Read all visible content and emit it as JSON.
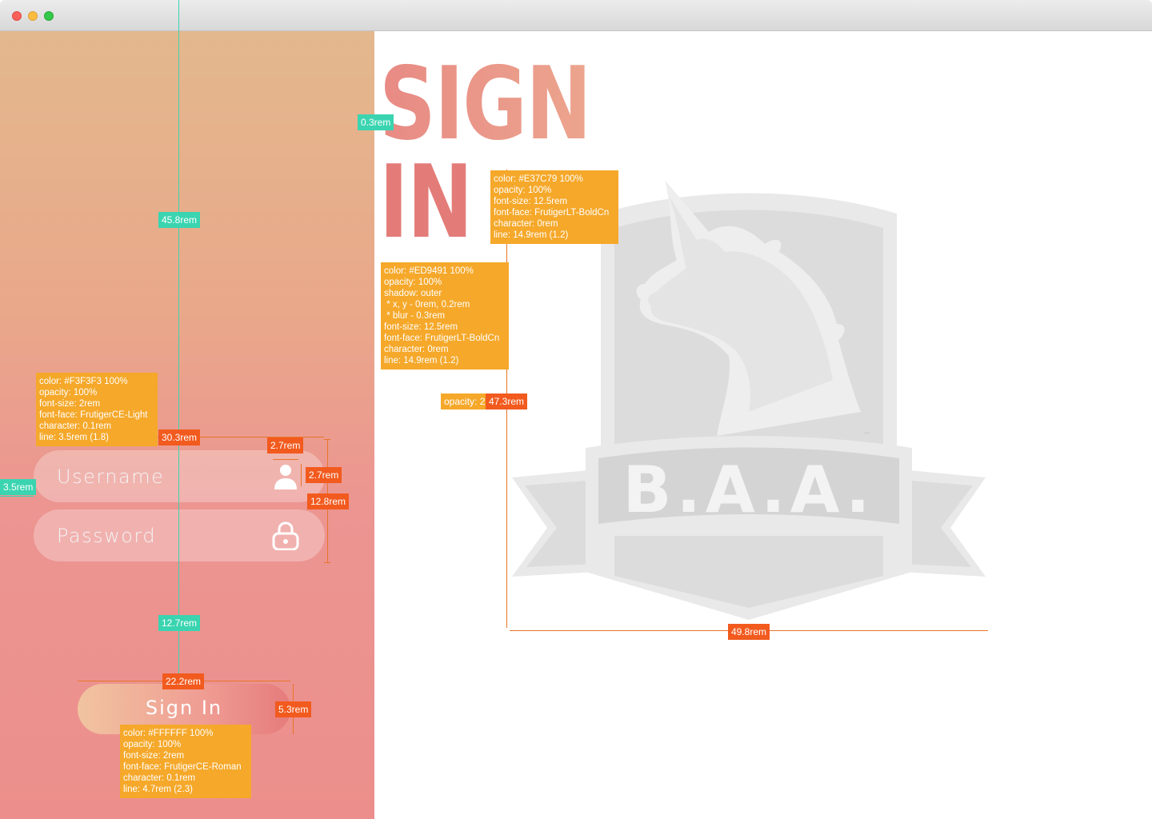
{
  "window": {
    "controls": [
      "close",
      "minimize",
      "maximize"
    ]
  },
  "form": {
    "username_placeholder": "Username",
    "password_placeholder": "Password",
    "signin_label": "Sign In",
    "username_icon": "user-icon",
    "password_icon": "lock-icon"
  },
  "heading": {
    "line1": "SIGN",
    "line2": "IN"
  },
  "logo": {
    "text": "B.A.A.",
    "mark": "™",
    "icon": "unicorn-shield-logo"
  },
  "annotations": {
    "heading_in": "color: #E37C79 100%\nopacity: 100%\nfont-size: 12.5rem\nfont-face: FrutigerLT-BoldCn\ncharacter: 0rem\nline: 14.9rem (1.2)",
    "heading_sign": "color: #ED9491 100%\nopacity: 100%\nshadow: outer\n * x, y - 0rem, 0.2rem\n * blur - 0.3rem\nfont-size: 12.5rem\nfont-face: FrutigerLT-BoldCn\ncharacter: 0rem\nline: 14.9rem (1.2)",
    "input_text": "color: #F3F3F3 100%\nopacity: 100%\nfont-size: 2rem\nfont-face: FrutigerCE-Light\ncharacter: 0.1rem\nline: 3.5rem (1.8)",
    "button_text": "color: #FFFFFF 100%\nopacity: 100%\nfont-size: 2rem\nfont-face: FrutigerCE-Roman\ncharacter: 0.1rem\nline: 4.7rem (2.3)",
    "logo_opacity": "opacity: 2"
  },
  "measures": {
    "m_0_3": "0.3rem",
    "m_45_8": "45.8rem",
    "m_30_3": "30.3rem",
    "m_2_7a": "2.7rem",
    "m_2_7b": "2.7rem",
    "m_3_5": "3.5rem",
    "m_12_8": "12.8rem",
    "m_12_7": "12.7rem",
    "m_22_2": "22.2rem",
    "m_5_3": "5.3rem",
    "m_47_3": "47.3rem",
    "m_49_8": "49.8rem"
  },
  "colors": {
    "accent_in": "#E37C79",
    "accent_sign": "#ED9491",
    "input_text": "#F3F3F3",
    "measure_orange": "#F25A1E",
    "measure_teal": "#3AD4B0",
    "annotation": "#F5A82A"
  }
}
